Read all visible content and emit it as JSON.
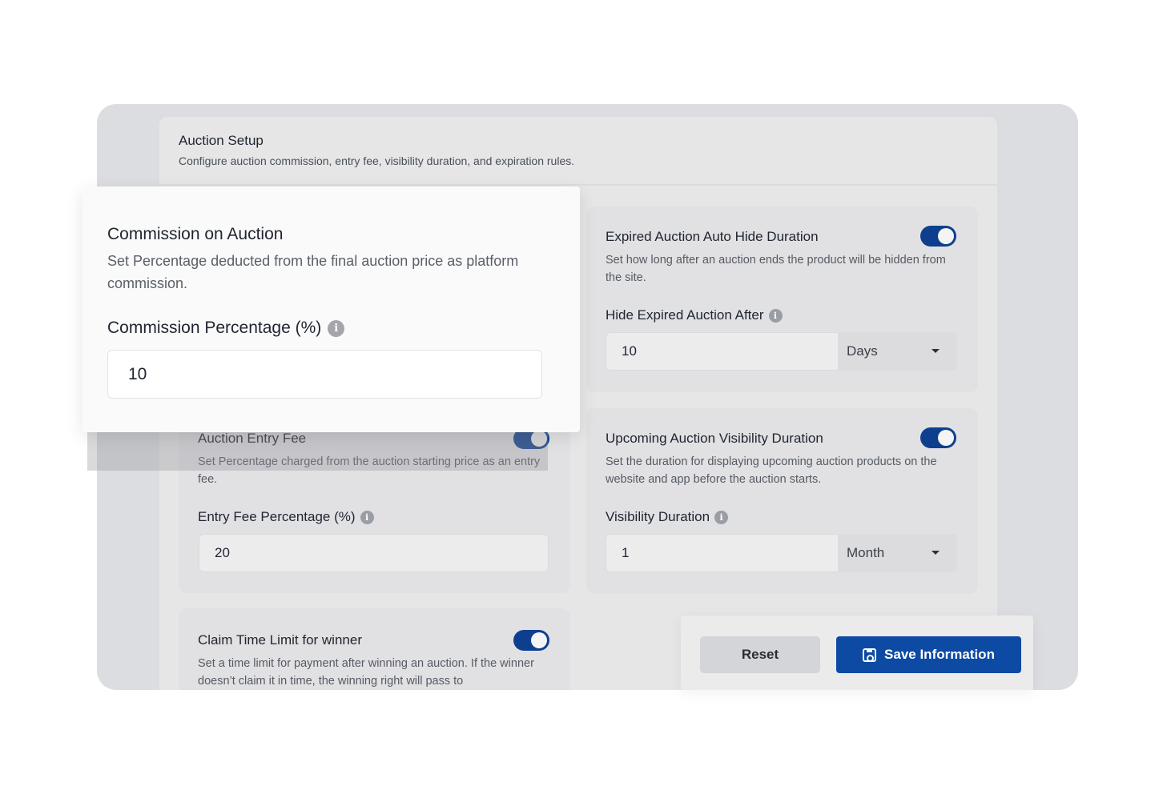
{
  "setup": {
    "title": "Auction Setup",
    "subtitle": "Configure auction commission, entry fee, visibility duration, and expiration rules."
  },
  "commission": {
    "title": "Commission on Auction",
    "description": "Set Percentage deducted from the final auction price as platform commission.",
    "field_label": "Commission Percentage (%)",
    "value": "10"
  },
  "entry_fee": {
    "title": "Auction Entry Fee",
    "enabled": true,
    "description": "Set Percentage charged from the auction starting price as an entry fee.",
    "field_label": "Entry Fee Percentage (%)",
    "value": "20"
  },
  "claim_time": {
    "title": "Claim Time Limit for winner",
    "enabled": true,
    "description": "Set a time limit for payment after winning an auction. If the winner doesn’t claim it in time, the winning right will pass to"
  },
  "expired_hide": {
    "title": "Expired Auction Auto Hide Duration",
    "enabled": true,
    "description": "Set how long after an auction ends the product will be hidden from the site.",
    "field_label": "Hide Expired Auction After",
    "value": "10",
    "unit": "Days"
  },
  "upcoming_visibility": {
    "title": "Upcoming Auction Visibility Duration",
    "enabled": true,
    "description": "Set the duration for displaying upcoming auction products on the website and app before the auction starts.",
    "field_label": "Visibility Duration",
    "value": "1",
    "unit": "Month"
  },
  "actions": {
    "reset_label": "Reset",
    "save_label": "Save Information"
  },
  "colors": {
    "primary": "#0d4aa3",
    "toggle_on": "#0e3f8f"
  },
  "info_glyph": "i"
}
